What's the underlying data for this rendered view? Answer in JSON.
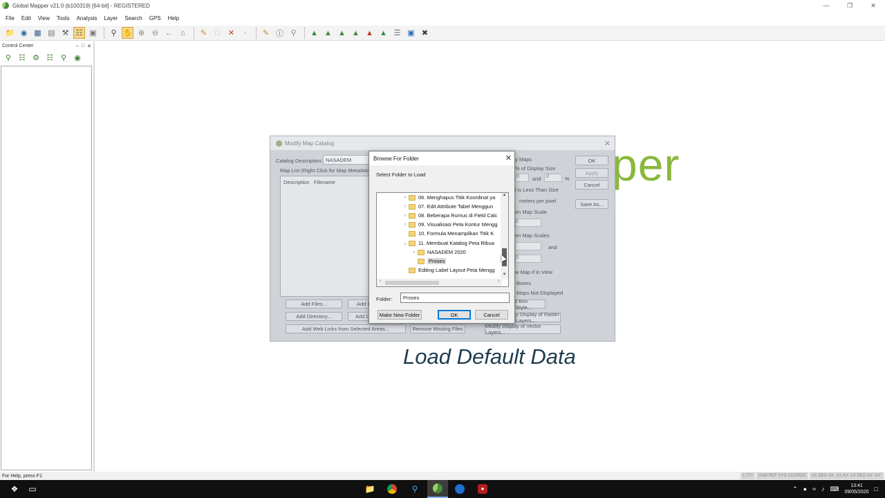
{
  "window": {
    "title": "Global Mapper v21.0 (b100319) [64-bit] - REGISTERED",
    "controls": [
      "—",
      "❐",
      "✕"
    ]
  },
  "menu": [
    "File",
    "Edit",
    "View",
    "Tools",
    "Analysis",
    "Layer",
    "Search",
    "GPS",
    "Help"
  ],
  "control_center": {
    "title": "Control Center",
    "buttons": [
      "–",
      "□",
      "✕"
    ]
  },
  "splash": {
    "logo_fragment": "per",
    "subtitle": "Load Default Data",
    "logo_color": "#8ab83d",
    "subtitle_color": "#1f3c4f"
  },
  "modify_catalog": {
    "title": "Modify Map Catalog",
    "catalog_description_label": "Catalog Description:",
    "catalog_description_value": "NASADEM",
    "map_list_label": "Map List (Right Click for Map Metadata D",
    "columns": [
      "Description",
      "Filename"
    ],
    "buttons": {
      "ok": "OK",
      "apply": "Apply",
      "cancel": "Cancel",
      "save_as": "Save As...",
      "add_files": "Add Files...",
      "add_l": "Add L",
      "add_directory": "Add Directory...",
      "add_d": "Add D",
      "add_web_links": "Add Web Links from Selected Areas...",
      "remove_missing": "Remove Missing Files",
      "box_style": "t Box Style...",
      "modify_raster": "y Display of Raster Layers...",
      "modify_vector": "Modify Display of Vector Layers..."
    },
    "right_labels": {
      "maps": "y Maps",
      "pct_display": "% of Display Size",
      "and1": "and",
      "pct": "%",
      "less_than": "l is Less Than Size",
      "meters": "meters per pixel",
      "map_scale": "en Map Scale",
      "map_scales": "en Map Scales",
      "and2": "and",
      "map_in_view": "w Map if in View",
      "boxes": "Boxes",
      "not_displayed": "Maps Not Displayed"
    },
    "inputs": {
      "pct_from": "0",
      "pct_to": "0",
      "scale_val": "0",
      "scale_val2": "0"
    }
  },
  "browse_folder": {
    "title": "Browse For Folder",
    "close": "✕",
    "subtitle": "Select Folder to Load",
    "tree": [
      {
        "label": "06. Menghapus Titik Koordinat ya",
        "chevron": "›",
        "indent": 1,
        "selected": false
      },
      {
        "label": "07. Edit Attribute Tabel Menggun",
        "chevron": "›",
        "indent": 1,
        "selected": false
      },
      {
        "label": "08. Beberapa Rumus di Field Calc",
        "chevron": "›",
        "indent": 1,
        "selected": false
      },
      {
        "label": "09. Visualisasi Peta Kontur Mengg",
        "chevron": "›",
        "indent": 1,
        "selected": false
      },
      {
        "label": "10. Formula Menampilkan Titik K",
        "chevron": "",
        "indent": 1,
        "selected": false
      },
      {
        "label": "11. Membuat Katalog Peta Ribua",
        "chevron": "⌄",
        "indent": 1,
        "selected": false
      },
      {
        "label": "NASADEM 2020",
        "chevron": "›",
        "indent": 2,
        "selected": false
      },
      {
        "label": "Proses",
        "chevron": "",
        "indent": 2,
        "selected": true
      },
      {
        "label": "Editing Label Layout Peta Mengg",
        "chevron": "",
        "indent": 1,
        "selected": false
      }
    ],
    "folder_label": "Folder:",
    "folder_value": "Proses",
    "buttons": {
      "make_new_folder": "Make New Folder",
      "ok": "OK",
      "cancel": "Cancel"
    }
  },
  "statusbar": {
    "help_text": "For Help, press F1",
    "panes": [
      "1:777",
      "GND REF SYS COORDS",
      "XX DEG XX, XX.XX' XX DEG XX' XX\""
    ]
  },
  "taskbar": {
    "clock_time": "13:41",
    "clock_date": "09/05/2020"
  }
}
